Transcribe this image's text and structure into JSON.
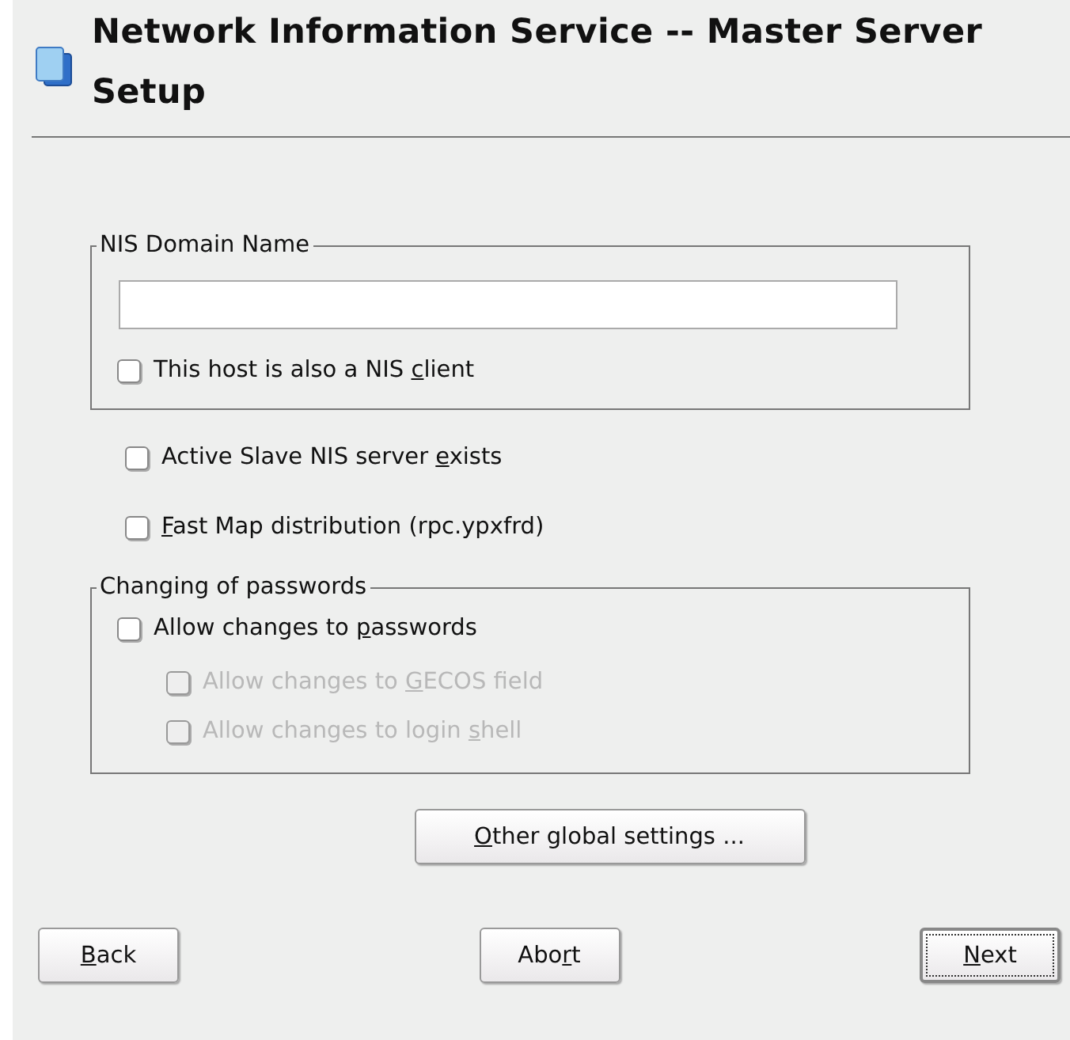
{
  "title": "Network Information Service -- Master Server Setup",
  "domain_group": {
    "label": "NIS Domain Name",
    "options": [
      {
        "label": {
          "before": "This host is also a NIS ",
          "key": "c",
          "after": "lient"
        },
        "checked": false,
        "disabled": false
      }
    ]
  },
  "options": [
    {
      "label": {
        "before": "Active Slave NIS server ",
        "key": "e",
        "after": "xists"
      },
      "checked": false,
      "disabled": false
    },
    {
      "label": {
        "key": "F",
        "after": "ast Map distribution (rpc.ypxfrd)"
      },
      "checked": false,
      "disabled": false
    }
  ],
  "password_group": {
    "label": "Changing of passwords",
    "options": [
      {
        "label": {
          "before": "Allow changes to ",
          "key": "p",
          "after": "asswords"
        },
        "checked": false,
        "disabled": false,
        "children": [
          {
            "label": {
              "before": "Allow changes to ",
              "key": "G",
              "after": "ECOS field"
            },
            "checked": false,
            "disabled": true
          },
          {
            "label": {
              "before": "Allow changes to login ",
              "key": "s",
              "after": "hell"
            },
            "checked": false,
            "disabled": true
          }
        ]
      }
    ]
  },
  "settings_button": {
    "key": "O",
    "after": "ther global settings ..."
  },
  "buttons": [
    {
      "label": {
        "key": "B",
        "after": "ack"
      },
      "focused": false
    },
    {
      "label": {
        "before": "Abo",
        "key": "r",
        "after": "t"
      },
      "focused": false
    },
    {
      "label": {
        "key": "N",
        "after": "ext"
      },
      "focused": true
    }
  ]
}
